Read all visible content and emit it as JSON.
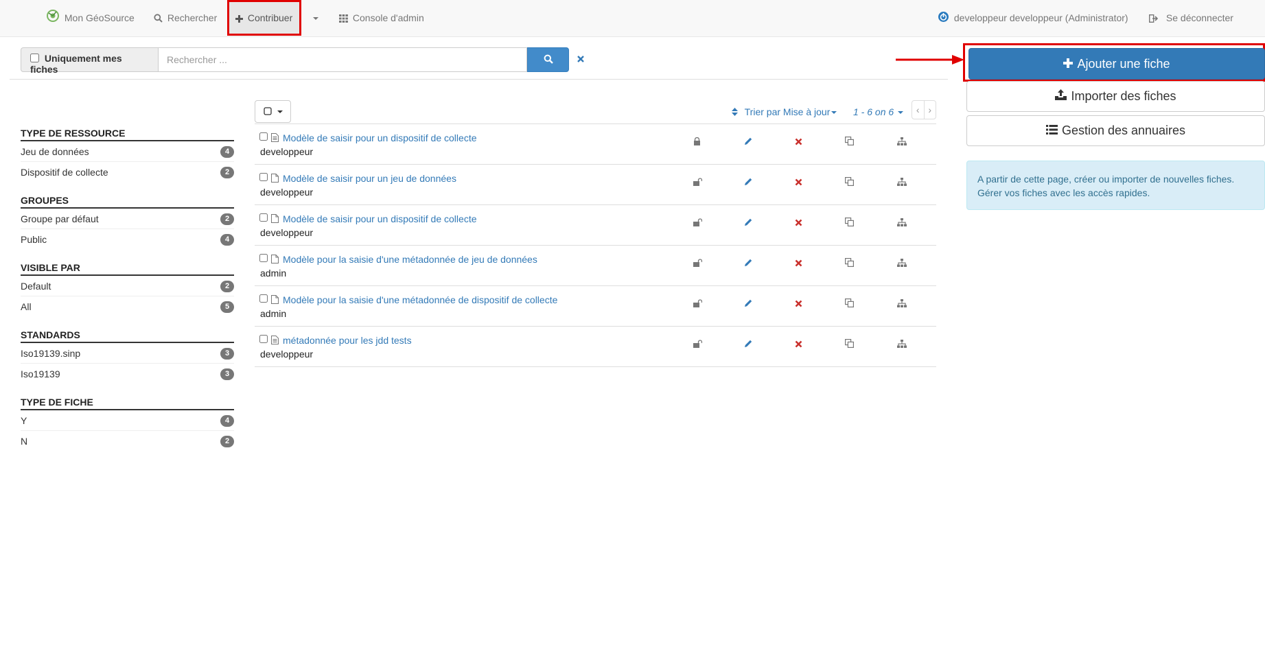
{
  "navbar": {
    "brand_label": "Mon GéoSource",
    "search_label": "Rechercher",
    "contribute_label": "Contribuer",
    "admin_label": "Console d'admin",
    "user_label": "developpeur developpeur (Administrator)",
    "logout_label": "Se déconnecter"
  },
  "search": {
    "only_mine_label": "Uniquement mes fiches",
    "placeholder": "Rechercher ..."
  },
  "facets": [
    {
      "title": "TYPE DE RESSOURCE",
      "items": [
        {
          "label": "Jeu de données",
          "count": "4"
        },
        {
          "label": "Dispositif de collecte",
          "count": "2"
        }
      ]
    },
    {
      "title": "GROUPES",
      "items": [
        {
          "label": "Groupe par défaut",
          "count": "2"
        },
        {
          "label": "Public",
          "count": "4"
        }
      ]
    },
    {
      "title": "VISIBLE PAR",
      "items": [
        {
          "label": "Default",
          "count": "2"
        },
        {
          "label": "All",
          "count": "5"
        }
      ]
    },
    {
      "title": "STANDARDS",
      "items": [
        {
          "label": "Iso19139.sinp",
          "count": "3"
        },
        {
          "label": "Iso19139",
          "count": "3"
        }
      ]
    },
    {
      "title": "TYPE DE FICHE",
      "items": [
        {
          "label": "Y",
          "count": "4"
        },
        {
          "label": "N",
          "count": "2"
        }
      ]
    }
  ],
  "results_toolbar": {
    "sort_label": "Trier par Mise à jour",
    "paging_label": "1 - 6 on 6"
  },
  "results": [
    {
      "title": "Modèle de saisir pour un dispositif de collecte",
      "owner": "developpeur",
      "doc_icon": "file-text-icon",
      "locked": true
    },
    {
      "title": "Modèle de saisir pour un jeu de données",
      "owner": "developpeur",
      "doc_icon": "file-icon",
      "locked": false
    },
    {
      "title": "Modèle de saisir pour un dispositif de collecte",
      "owner": "developpeur",
      "doc_icon": "file-icon",
      "locked": false
    },
    {
      "title": "Modèle pour la saisie d'une métadonnée de jeu de données",
      "owner": "admin",
      "doc_icon": "file-icon",
      "locked": false
    },
    {
      "title": "Modèle pour la saisie d'une métadonnée de dispositif de collecte",
      "owner": "admin",
      "doc_icon": "file-icon",
      "locked": false
    },
    {
      "title": "métadonnée pour les jdd tests",
      "owner": "developpeur",
      "doc_icon": "file-text-icon",
      "locked": false
    }
  ],
  "actions": {
    "add_label": "Ajouter une fiche",
    "import_label": "Importer des fiches",
    "directory_label": "Gestion des annuaires"
  },
  "info": {
    "line1": "A partir de cette page, créer ou importer de nouvelles fiches.",
    "line2": "Gérer vos fiches avec les accès rapides."
  },
  "colors": {
    "primary": "#337ab7",
    "highlight": "#e00000",
    "danger": "#c9302c",
    "info_bg": "#d9edf7"
  }
}
